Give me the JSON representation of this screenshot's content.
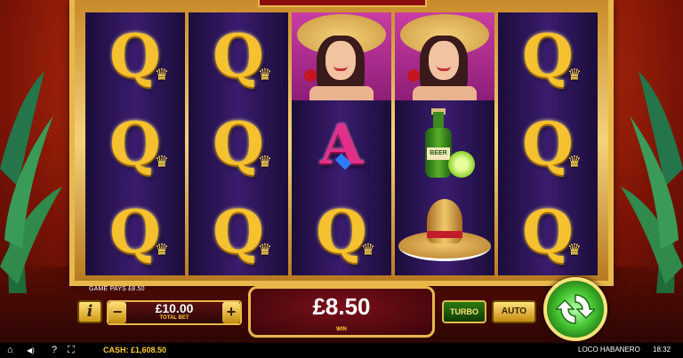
{
  "reels": [
    [
      "Q",
      "Q",
      "Q"
    ],
    [
      "Q",
      "Q",
      "Q"
    ],
    [
      "lady",
      "A",
      "Q"
    ],
    [
      "lady",
      "bottle",
      "sombrero"
    ],
    [
      "Q",
      "Q",
      "Q"
    ]
  ],
  "symbols": {
    "q_letter": "Q",
    "a_letter": "A",
    "bottle_label": "BEER",
    "crown_glyph": "♛"
  },
  "hud": {
    "game_pays": "GAME PAYS £8.50",
    "info_label": "i",
    "minus_label": "−",
    "plus_label": "+",
    "total_bet_value": "£10.00",
    "total_bet_label": "TOTAL BET",
    "win_value": "£8.50",
    "win_label": "WIN",
    "turbo_label": "TURBO",
    "auto_label": "AUTO"
  },
  "statusbar": {
    "home_icon": "⌂",
    "sound_icon": "◀)",
    "help_icon": "?",
    "fullscreen_icon": "⛶",
    "cash_text": "CASH:  £1,608.50",
    "game_name": "LOCO HABANERO",
    "clock": "18:32"
  },
  "colors": {
    "gold": "#e8b84a",
    "reel_bg": "#3a1c6e",
    "win_text": "#ffcc33",
    "spin_green": "#46c431"
  }
}
